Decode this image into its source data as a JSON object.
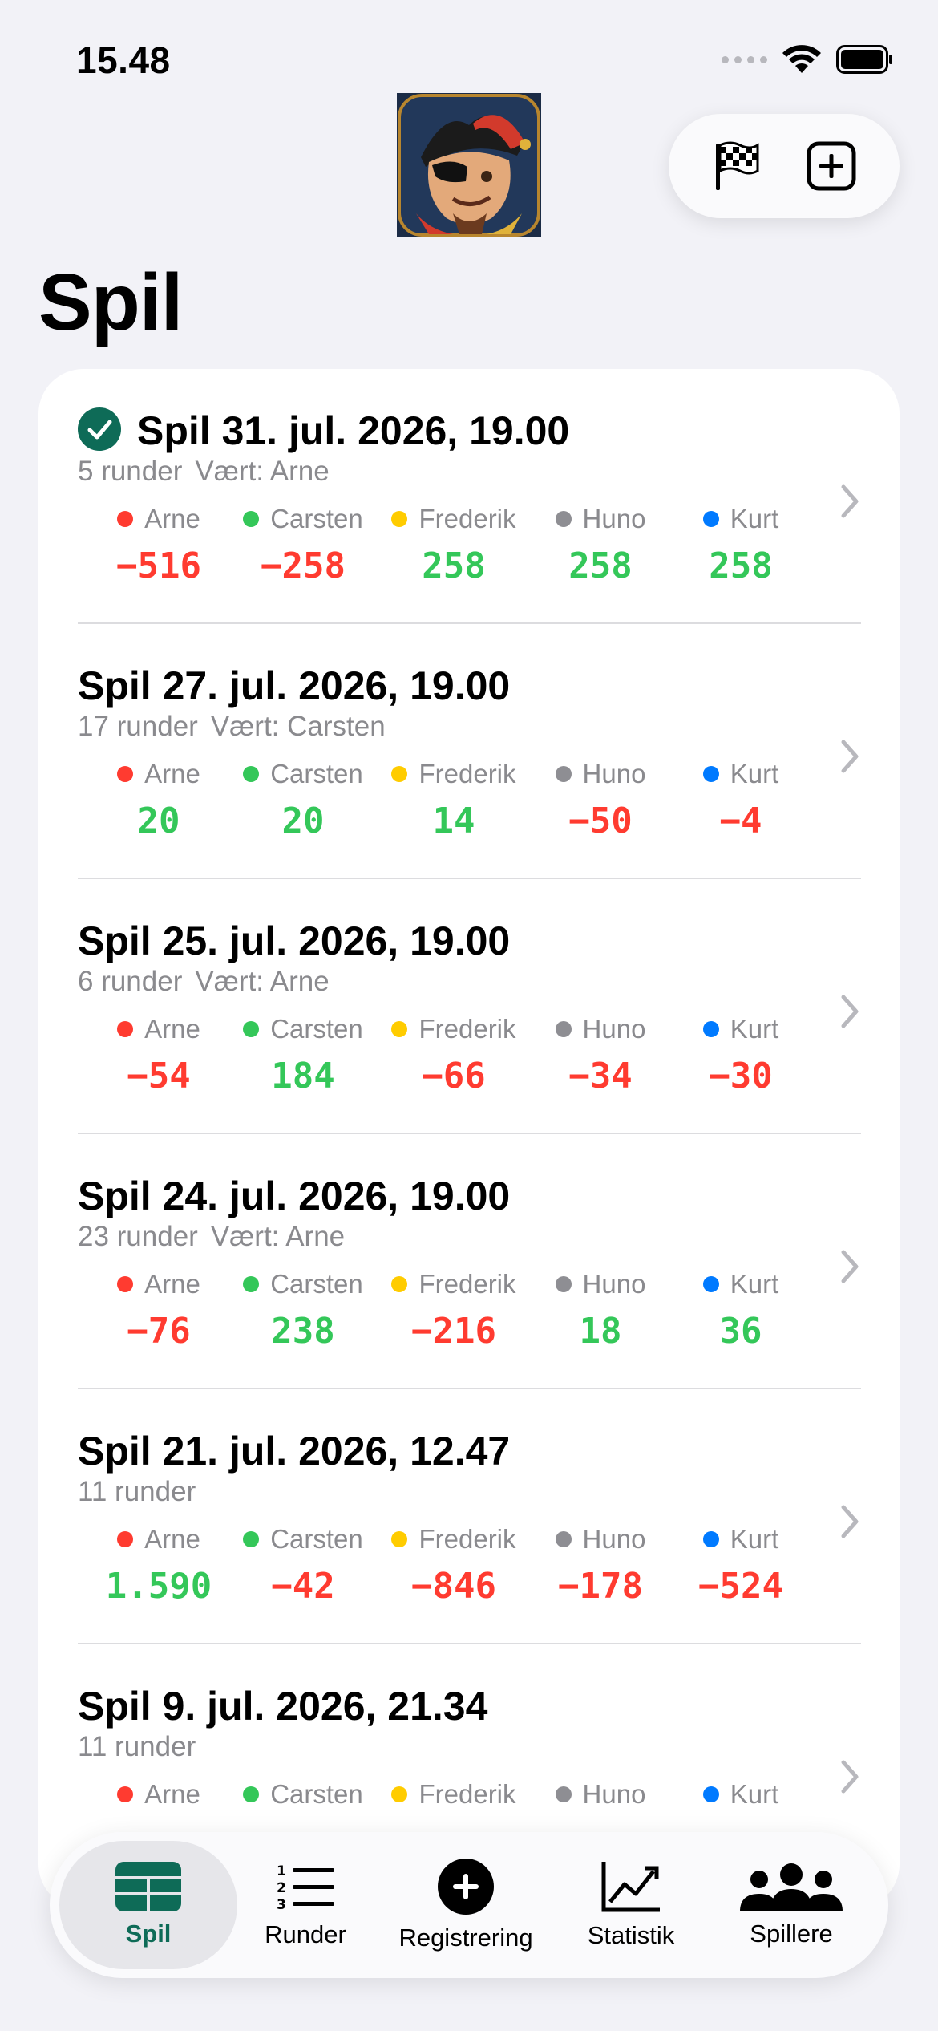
{
  "status_bar": {
    "time": "15.48"
  },
  "title": "Spil",
  "colors": {
    "accent": "#0e6b57",
    "positive": "#34c759",
    "negative": "#ff3b30",
    "players": {
      "Arne": "#ff3b30",
      "Carsten": "#34c759",
      "Frederik": "#ffcc00",
      "Huno": "#8e8e93",
      "Kurt": "#007aff"
    }
  },
  "toolbar": {
    "finish_icon": "checkered-flag-icon",
    "add_icon": "plus-square-icon"
  },
  "games": [
    {
      "title": "Spil 31. jul. 2026, 19.00",
      "completed": true,
      "rounds": "5 runder",
      "host": "Vært: Arne",
      "players": [
        {
          "name": "Arne",
          "score": "−516",
          "sign": "neg"
        },
        {
          "name": "Carsten",
          "score": "−258",
          "sign": "neg"
        },
        {
          "name": "Frederik",
          "score": "258",
          "sign": "pos"
        },
        {
          "name": "Huno",
          "score": "258",
          "sign": "pos"
        },
        {
          "name": "Kurt",
          "score": "258",
          "sign": "pos"
        }
      ]
    },
    {
      "title": "Spil 27. jul. 2026, 19.00",
      "completed": false,
      "rounds": "17 runder",
      "host": "Vært: Carsten",
      "players": [
        {
          "name": "Arne",
          "score": "20",
          "sign": "pos"
        },
        {
          "name": "Carsten",
          "score": "20",
          "sign": "pos"
        },
        {
          "name": "Frederik",
          "score": "14",
          "sign": "pos"
        },
        {
          "name": "Huno",
          "score": "−50",
          "sign": "neg"
        },
        {
          "name": "Kurt",
          "score": "−4",
          "sign": "neg"
        }
      ]
    },
    {
      "title": "Spil 25. jul. 2026, 19.00",
      "completed": false,
      "rounds": "6 runder",
      "host": "Vært: Arne",
      "players": [
        {
          "name": "Arne",
          "score": "−54",
          "sign": "neg"
        },
        {
          "name": "Carsten",
          "score": "184",
          "sign": "pos"
        },
        {
          "name": "Frederik",
          "score": "−66",
          "sign": "neg"
        },
        {
          "name": "Huno",
          "score": "−34",
          "sign": "neg"
        },
        {
          "name": "Kurt",
          "score": "−30",
          "sign": "neg"
        }
      ]
    },
    {
      "title": "Spil 24. jul. 2026, 19.00",
      "completed": false,
      "rounds": "23 runder",
      "host": "Vært: Arne",
      "players": [
        {
          "name": "Arne",
          "score": "−76",
          "sign": "neg"
        },
        {
          "name": "Carsten",
          "score": "238",
          "sign": "pos"
        },
        {
          "name": "Frederik",
          "score": "−216",
          "sign": "neg"
        },
        {
          "name": "Huno",
          "score": "18",
          "sign": "pos"
        },
        {
          "name": "Kurt",
          "score": "36",
          "sign": "pos"
        }
      ]
    },
    {
      "title": "Spil 21. jul. 2026, 12.47",
      "completed": false,
      "rounds": "11 runder",
      "host": "",
      "players": [
        {
          "name": "Arne",
          "score": "1.590",
          "sign": "pos"
        },
        {
          "name": "Carsten",
          "score": "−42",
          "sign": "neg"
        },
        {
          "name": "Frederik",
          "score": "−846",
          "sign": "neg"
        },
        {
          "name": "Huno",
          "score": "−178",
          "sign": "neg"
        },
        {
          "name": "Kurt",
          "score": "−524",
          "sign": "neg"
        }
      ]
    },
    {
      "title": "Spil 9. jul. 2026, 21.34",
      "completed": false,
      "rounds": "11 runder",
      "host": "",
      "players": [
        {
          "name": "Arne",
          "score": "",
          "sign": "neg"
        },
        {
          "name": "Carsten",
          "score": "",
          "sign": "pos"
        },
        {
          "name": "Frederik",
          "score": "",
          "sign": "pos"
        },
        {
          "name": "Huno",
          "score": "",
          "sign": "neg"
        },
        {
          "name": "Kurt",
          "score": "",
          "sign": "neg"
        }
      ]
    }
  ],
  "tabs": [
    {
      "label": "Spil",
      "icon": "table-icon",
      "active": true
    },
    {
      "label": "Runder",
      "icon": "numbered-list-icon",
      "active": false
    },
    {
      "label": "Registrering",
      "icon": "plus-circle-icon",
      "active": false
    },
    {
      "label": "Statistik",
      "icon": "chart-line-icon",
      "active": false
    },
    {
      "label": "Spillere",
      "icon": "people-icon",
      "active": false
    }
  ]
}
